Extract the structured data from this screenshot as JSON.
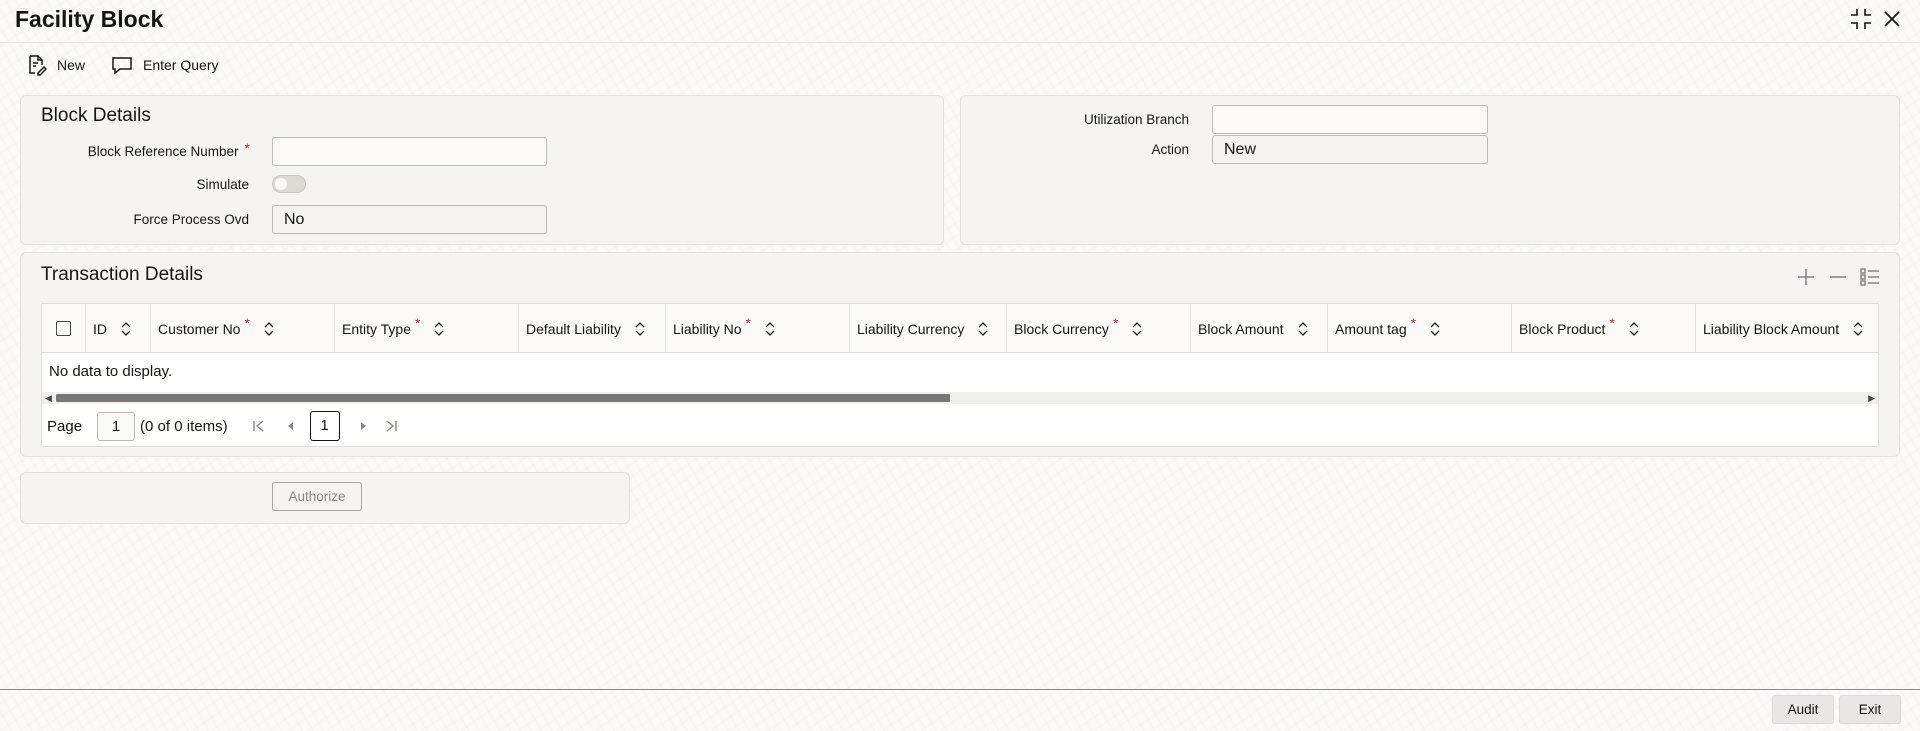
{
  "window": {
    "title": "Facility Block"
  },
  "toolbar": {
    "new_label": "New",
    "enter_query_label": "Enter Query"
  },
  "block_details": {
    "title": "Block Details",
    "block_reference_number": {
      "label": "Block Reference Number",
      "value": ""
    },
    "simulate": {
      "label": "Simulate",
      "enabled": false
    },
    "force_process_ovd": {
      "label": "Force Process Ovd",
      "value": "No"
    }
  },
  "right_panel": {
    "utilization_branch": {
      "label": "Utilization Branch",
      "value": ""
    },
    "action": {
      "label": "Action",
      "value": "New"
    }
  },
  "transaction_details": {
    "title": "Transaction Details",
    "columns": [
      {
        "label": "ID",
        "required": false
      },
      {
        "label": "Customer No",
        "required": true
      },
      {
        "label": "Entity Type",
        "required": true
      },
      {
        "label": "Default Liability",
        "required": false
      },
      {
        "label": "Liability No",
        "required": true
      },
      {
        "label": "Liability Currency",
        "required": false
      },
      {
        "label": "Block Currency",
        "required": true
      },
      {
        "label": "Block Amount",
        "required": false
      },
      {
        "label": "Amount tag",
        "required": true
      },
      {
        "label": "Block Product",
        "required": true
      },
      {
        "label": "Liability Block Amount",
        "required": false
      }
    ],
    "empty_text": "No data to display.",
    "pagination": {
      "page_label": "Page",
      "page_value": "1",
      "count_text": "(0 of 0 items)",
      "current_page": "1"
    }
  },
  "authorize_label": "Authorize",
  "footer": {
    "audit_label": "Audit",
    "exit_label": "Exit"
  },
  "icons": {
    "new": "new-document-icon",
    "enter_query": "chat-bubble-icon",
    "minimize": "collapse-icon",
    "close": "close-icon",
    "add_row": "plus-icon",
    "delete_row": "minus-icon",
    "single_view": "list-view-icon"
  },
  "colors": {
    "required": "#c1272d",
    "background": "#fbfaf8",
    "panel": "#f5f4f2",
    "scroll_thumb": "#7a7874"
  }
}
